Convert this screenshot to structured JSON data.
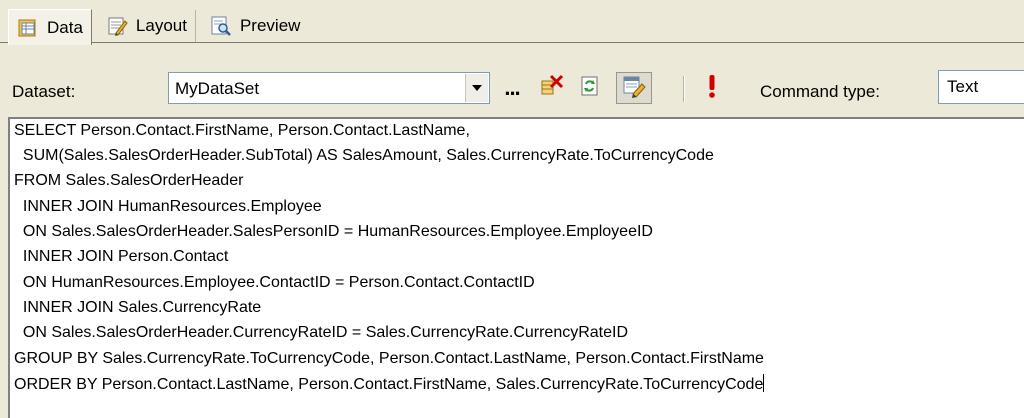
{
  "tabs": [
    {
      "label": "Data",
      "icon": "data-icon",
      "active": true
    },
    {
      "label": "Layout",
      "icon": "layout-icon",
      "active": false
    },
    {
      "label": "Preview",
      "icon": "preview-icon",
      "active": false
    }
  ],
  "toolbar": {
    "dataset_label": "Dataset:",
    "dataset_value": "MyDataSet",
    "ellipsis": "...",
    "command_type_label": "Command type:",
    "command_type_value": "Text",
    "buttons": [
      "delete-dataset-icon",
      "refresh-fields-icon",
      "generic-query-designer-icon",
      "run-query-icon"
    ]
  },
  "query": {
    "lines": [
      "SELECT Person.Contact.FirstName, Person.Contact.LastName,",
      "  SUM(Sales.SalesOrderHeader.SubTotal) AS SalesAmount, Sales.CurrencyRate.ToCurrencyCode",
      "FROM Sales.SalesOrderHeader",
      "  INNER JOIN HumanResources.Employee",
      "  ON Sales.SalesOrderHeader.SalesPersonID = HumanResources.Employee.EmployeeID",
      "  INNER JOIN Person.Contact",
      "  ON HumanResources.Employee.ContactID = Person.Contact.ContactID",
      "  INNER JOIN Sales.CurrencyRate",
      "  ON Sales.SalesOrderHeader.CurrencyRateID = Sales.CurrencyRate.CurrencyRateID",
      "GROUP BY Sales.CurrencyRate.ToCurrencyCode, Person.Contact.LastName, Person.Contact.FirstName",
      "ORDER BY Person.Contact.LastName, Person.Contact.FirstName, Sales.CurrencyRate.ToCurrencyCode"
    ]
  },
  "colors": {
    "accent_red": "#d40000",
    "chrome": "#ece9d8",
    "input_border": "#7f9db9"
  }
}
